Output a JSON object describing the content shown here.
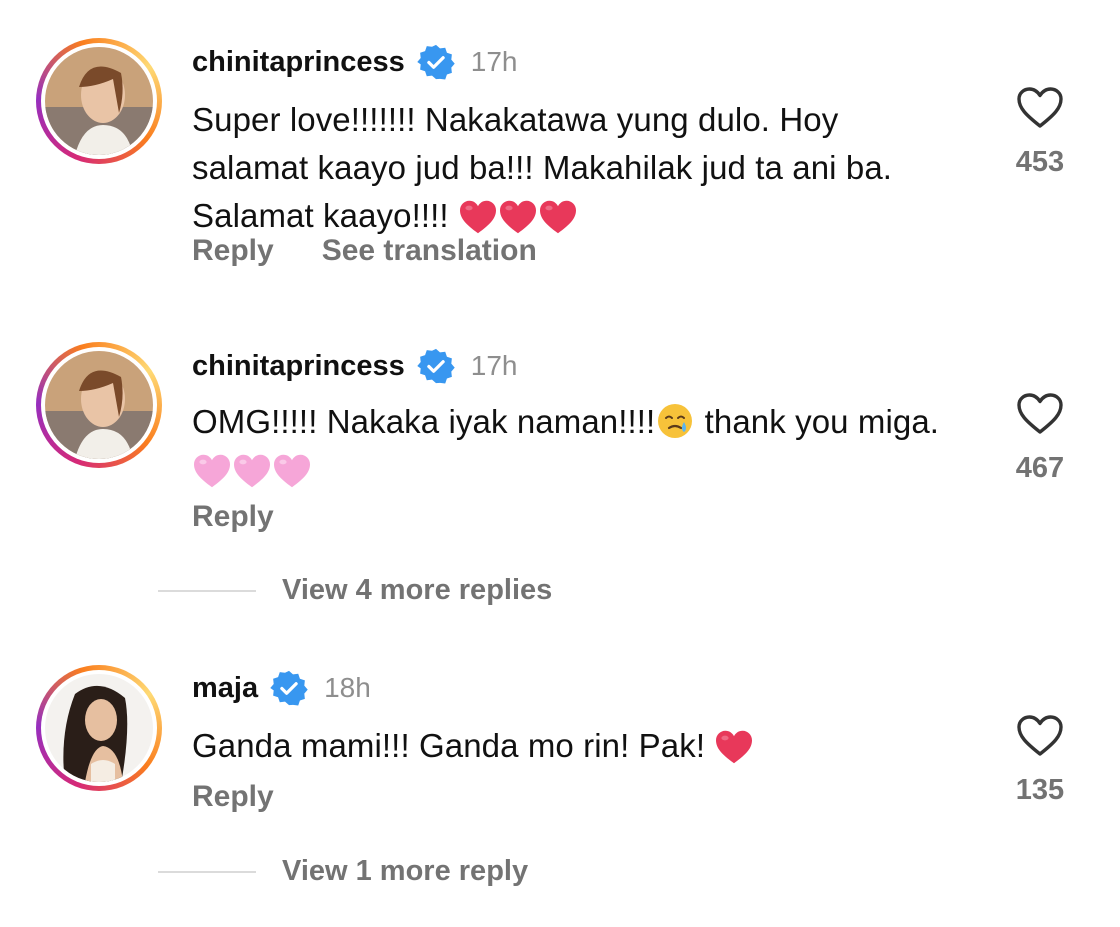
{
  "comments": [
    {
      "username": "chinitaprincess",
      "verified": true,
      "time": "17h",
      "text": "Super love!!!!!!! Nakakatawa yung dulo. Hoy salamat kaayo jud ba!!! Makahilak jud ta ani ba. Salamat kaayo!!!!",
      "emoji": [
        "red-heart",
        "red-heart",
        "red-heart"
      ],
      "likes": "453",
      "reply_label": "Reply",
      "translate_label": "See translation"
    },
    {
      "username": "chinitaprincess",
      "verified": true,
      "time": "17h",
      "text_before_emoji": "OMG!!!!! Nakaka iyak naman!!!!",
      "inline_emoji": "face-holding-back-tears",
      "text_after_emoji": " thank you miga.",
      "emoji": [
        "pink-heart",
        "pink-heart",
        "pink-heart"
      ],
      "likes": "467",
      "reply_label": "Reply",
      "view_more": "View 4 more replies"
    },
    {
      "username": "maja",
      "verified": true,
      "time": "18h",
      "text": "Ganda mami!!! Ganda mo rin! Pak!",
      "emoji": [
        "red-heart"
      ],
      "likes": "135",
      "reply_label": "Reply",
      "view_more": "View 1 more reply"
    }
  ],
  "colors": {
    "verified_blue": "#3897f0",
    "muted_text": "#737373",
    "red_heart": "#e8385a",
    "pink_heart": "#f6a6d8"
  }
}
